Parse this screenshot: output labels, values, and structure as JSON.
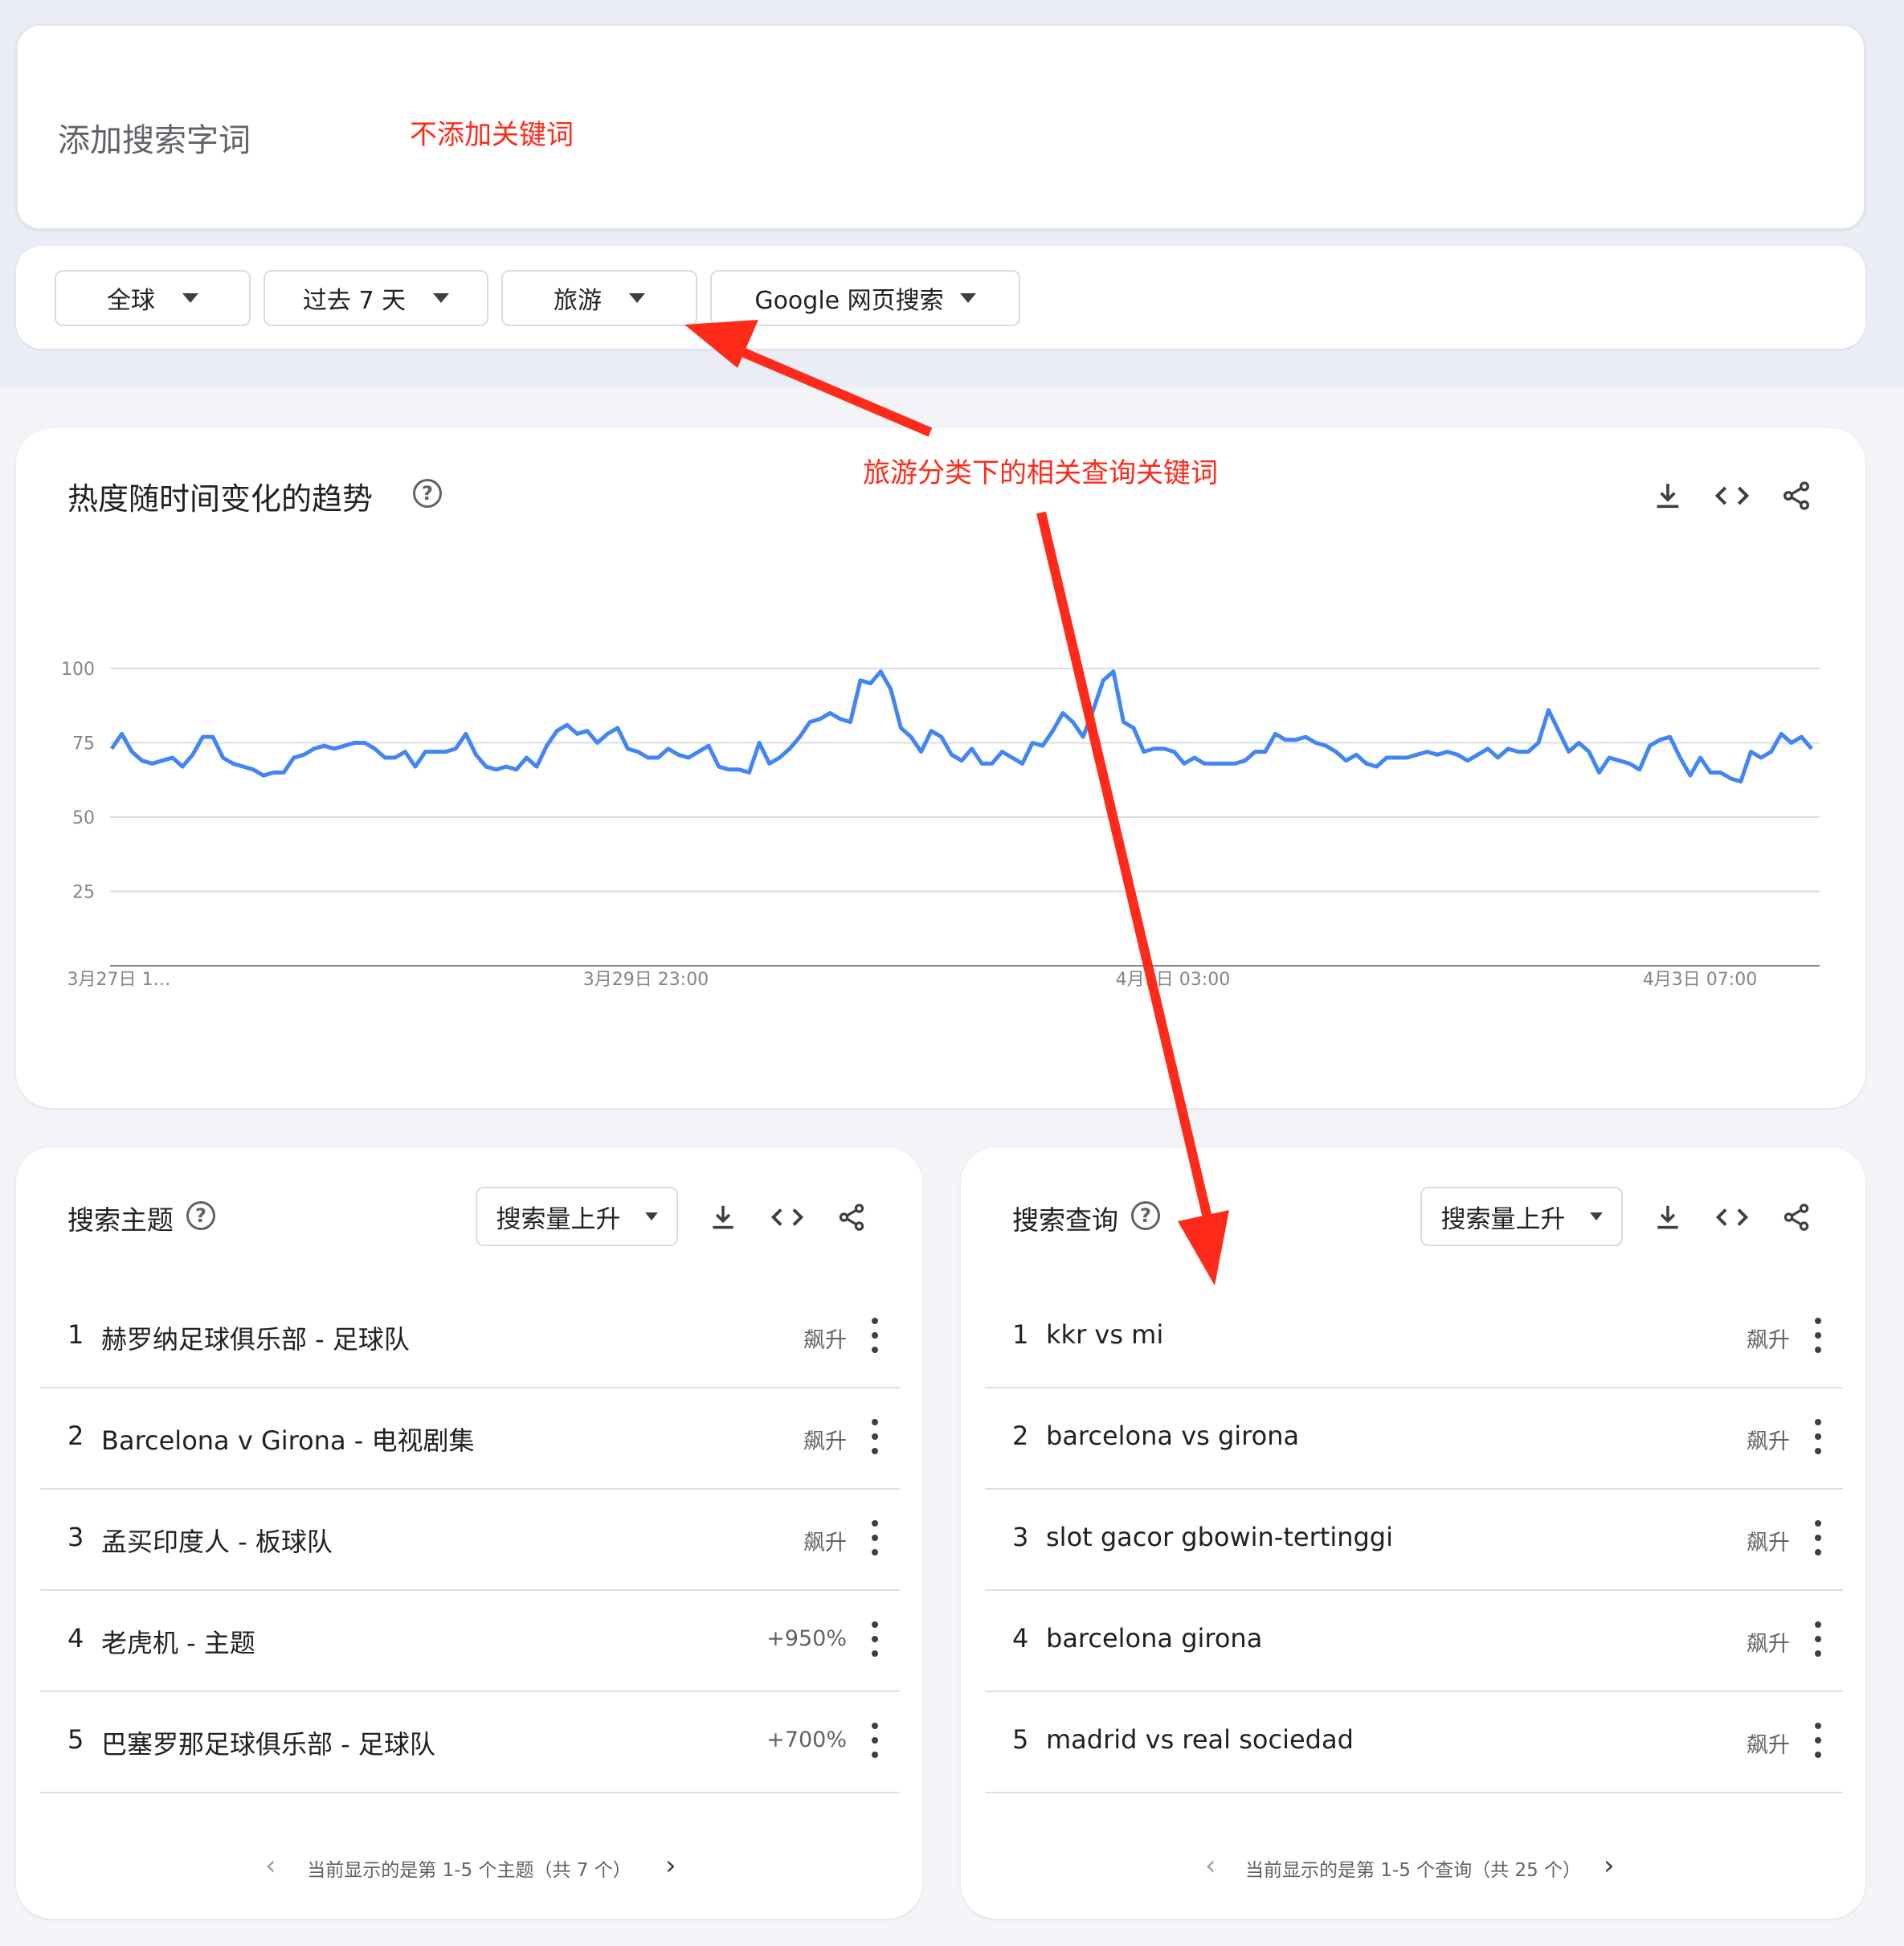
{
  "search": {
    "placeholder": "添加搜索字词"
  },
  "annotations": {
    "no_keyword": "不添加关键词",
    "category_related": "旅游分类下的相关查询关键词"
  },
  "filters": {
    "region": "全球",
    "time": "过去 7 天",
    "category": "旅游",
    "property": "Google 网页搜索"
  },
  "trend": {
    "title": "热度随时间变化的趋势",
    "help": "?",
    "chart_data": {
      "type": "line",
      "yticks": [
        "100",
        "75",
        "50",
        "25"
      ],
      "xticks": [
        "3月27日 1…",
        "3月29日 23:00",
        "4月1日 03:00",
        "4月3日 07:00"
      ],
      "ylim": [
        0,
        100
      ],
      "grid": true,
      "color": "#4285f4",
      "values": [
        73,
        78,
        72,
        69,
        68,
        69,
        70,
        67,
        71,
        77,
        77,
        70,
        68,
        67,
        66,
        64,
        65,
        65,
        70,
        71,
        73,
        74,
        73,
        74,
        75,
        75,
        73,
        70,
        70,
        72,
        67,
        72,
        72,
        72,
        73,
        78,
        71,
        67,
        66,
        67,
        66,
        70,
        67,
        74,
        79,
        81,
        78,
        79,
        75,
        78,
        80,
        73,
        72,
        70,
        70,
        73,
        71,
        70,
        72,
        74,
        67,
        66,
        66,
        65,
        75,
        68,
        70,
        73,
        77,
        82,
        83,
        85,
        83,
        82,
        96,
        95,
        99,
        93,
        80,
        77,
        72,
        79,
        77,
        71,
        69,
        73,
        68,
        68,
        72,
        70,
        68,
        75,
        74,
        79,
        85,
        82,
        77,
        86,
        96,
        99,
        82,
        80,
        72,
        73,
        73,
        72,
        68,
        70,
        68,
        68,
        68,
        68,
        69,
        72,
        72,
        78,
        76,
        76,
        77,
        75,
        74,
        72,
        69,
        71,
        68,
        67,
        70,
        70,
        70,
        71,
        72,
        71,
        72,
        71,
        69,
        71,
        73,
        70,
        73,
        72,
        72,
        75,
        86,
        79,
        72,
        75,
        72,
        65,
        70,
        69,
        68,
        66,
        74,
        76,
        77,
        70,
        64,
        70,
        65,
        65,
        63,
        62,
        72,
        70,
        72,
        78,
        75,
        77,
        73
      ]
    }
  },
  "topics": {
    "title": "搜索主题",
    "help": "?",
    "sort_label": "搜索量上升",
    "items": [
      {
        "rank": "1",
        "label": "赫罗纳足球俱乐部 - 足球队",
        "value": "飙升"
      },
      {
        "rank": "2",
        "label": "Barcelona v Girona - 电视剧集",
        "value": "飙升"
      },
      {
        "rank": "3",
        "label": "孟买印度人 - 板球队",
        "value": "飙升"
      },
      {
        "rank": "4",
        "label": "老虎机 - 主题",
        "value": "+950%"
      },
      {
        "rank": "5",
        "label": "巴塞罗那足球俱乐部 - 足球队",
        "value": "+700%"
      }
    ],
    "pager": "当前显示的是第 1-5 个主题（共 7 个）"
  },
  "queries": {
    "title": "搜索查询",
    "help": "?",
    "sort_label": "搜索量上升",
    "items": [
      {
        "rank": "1",
        "label": "kkr vs mi",
        "value": "飙升"
      },
      {
        "rank": "2",
        "label": "barcelona vs girona",
        "value": "飙升"
      },
      {
        "rank": "3",
        "label": "slot gacor gbowin-tertinggi",
        "value": "飙升"
      },
      {
        "rank": "4",
        "label": "barcelona girona",
        "value": "飙升"
      },
      {
        "rank": "5",
        "label": "madrid vs real sociedad",
        "value": "飙升"
      }
    ],
    "pager": "当前显示的是第 1-5 个查询（共 25 个）"
  },
  "icons": [
    "download-icon",
    "embed-code-icon",
    "share-icon",
    "help-icon",
    "more-vert-icon",
    "chevron-left-icon",
    "chevron-right-icon"
  ]
}
